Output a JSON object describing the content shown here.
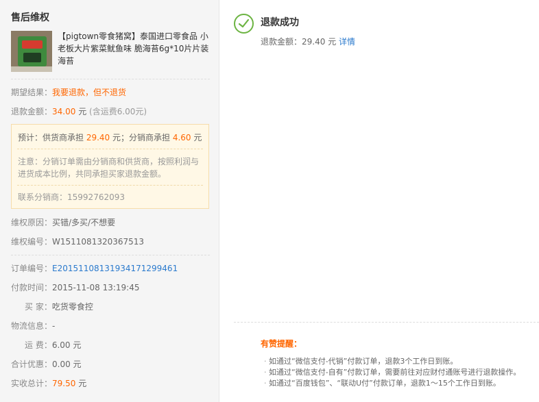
{
  "header": {
    "title": "售后维权"
  },
  "product": {
    "image_alt": "海苔",
    "title": "【pigtown零食猪窝】泰国进口零食品 小老板大片紫菜鱿鱼味 脆海苔6g*10片片装海苔"
  },
  "expect": {
    "label": "期望结果：",
    "value": "我要退款，但不退货"
  },
  "amount": {
    "label": "退款金额：",
    "value": "34.00",
    "unit": " 元",
    "note": " (含运费6.00元)"
  },
  "estimate": {
    "prefix": "预计：供货商承担 ",
    "supplier": "29.40",
    "mid": " 元；分销商承担 ",
    "distributor": "4.60",
    "suffix": " 元",
    "note": "注意：分销订单需由分销商和供货商，按照利润与进货成本比例，共同承担买家退款金额。",
    "contact_label": "联系分销商：",
    "contact_phone": "15992762093"
  },
  "reason": {
    "label": "维权原因：",
    "value": "买错/多买/不想要"
  },
  "case_no": {
    "label": "维权编号：",
    "value": "W1511081320367513"
  },
  "order": {
    "no_label": "订单编号：",
    "no_value": "E20151108131934171299461",
    "paid_label": "付款时间：",
    "paid_value": "2015-11-08 13:19:45",
    "buyer_label": "买 家：",
    "buyer_value": "吃货零食控",
    "logistics_label": "物流信息：",
    "logistics_value": "-",
    "freight_label": "运 费：",
    "freight_value": "6.00",
    "freight_unit": " 元",
    "discount_label": "合计优惠：",
    "discount_value": "0.00",
    "discount_unit": " 元",
    "total_label": "实收总计：",
    "total_value": "79.50",
    "total_unit": " 元"
  },
  "result": {
    "icon": "check-circle-icon",
    "title": "退款成功",
    "amount_label": "退款金额：",
    "amount_value": "29.40",
    "amount_unit": " 元 ",
    "detail_link": "详情"
  },
  "tips": {
    "title": "有赞提醒：",
    "items": [
      "如通过“微信支付-代销”付款订单，退款3个工作日到账。",
      "如通过“微信支付-自有”付款订单，需要前往对应财付通账号进行退款操作。",
      "如通过“百度钱包”、“联动U付”付款订单，退款1～15个工作日到账。"
    ]
  },
  "colors": {
    "accent": "#ff6600",
    "link": "#2b7acd",
    "success": "#6cb442",
    "notice_bg": "#fff8e6"
  }
}
